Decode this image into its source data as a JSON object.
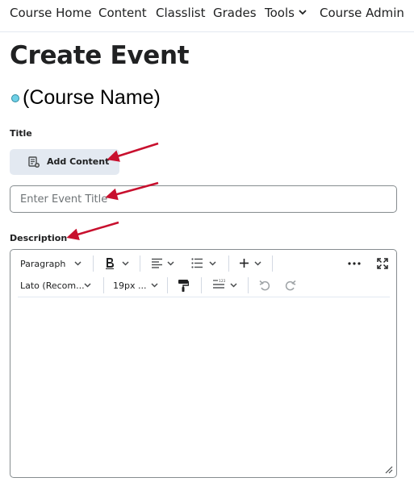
{
  "nav": {
    "items": [
      {
        "label": "Course Home"
      },
      {
        "label": "Content"
      },
      {
        "label": "Classlist"
      },
      {
        "label": "Grades"
      },
      {
        "label": "Tools"
      },
      {
        "label": "Course Admin"
      }
    ]
  },
  "page": {
    "title": "Create Event",
    "course_name": "(Course Name)"
  },
  "form": {
    "title_label": "Title",
    "add_content_label": "Add Content",
    "title_placeholder": "Enter Event Title",
    "description_label": "Description"
  },
  "editor": {
    "block_format": "Paragraph",
    "font_family": "Lato (Recom...",
    "font_size": "19px ..."
  },
  "colors": {
    "annotation_arrow": "#c8102e",
    "course_dot": "#6fd0e6"
  },
  "icons": [
    "chevron-down-icon",
    "add-content-icon",
    "bold-icon",
    "align-icon",
    "list-icon",
    "insert-plus-icon",
    "more-icon",
    "fullscreen-icon",
    "format-painter-icon",
    "line-spacing-icon",
    "undo-icon",
    "redo-icon",
    "resize-icon"
  ]
}
